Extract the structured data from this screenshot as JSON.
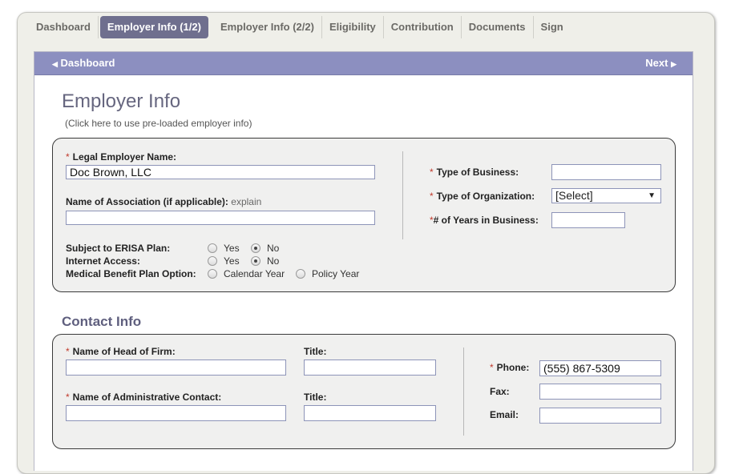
{
  "tabs": [
    "Dashboard",
    "Employer Info (1/2)",
    "Employer Info (2/2)",
    "Eligibility",
    "Contribution",
    "Documents",
    "Sign"
  ],
  "active_tab": "Employer Info (1/2)",
  "nav": {
    "back": "Dashboard",
    "next": "Next"
  },
  "page": {
    "title": "Employer Info",
    "preload_hint": "(Click here to use pre-loaded employer info)"
  },
  "employer": {
    "legal_name_label": "Legal Employer Name:",
    "legal_name_value": "Doc Brown, LLC",
    "association_label": "Name of Association (if applicable):",
    "association_explain": "explain",
    "association_value": "",
    "erisa_label": "Subject to ERISA Plan:",
    "internet_label": "Internet Access:",
    "medical_label": "Medical Benefit Plan Option:",
    "yes": "Yes",
    "no": "No",
    "calendar_year": "Calendar Year",
    "policy_year": "Policy Year",
    "erisa_selected": "No",
    "internet_selected": "No",
    "type_business_label": "Type of Business:",
    "type_business_value": "",
    "type_org_label": "Type of Organization:",
    "type_org_value": "[Select]",
    "years_label": "# of Years in Business:",
    "years_value": ""
  },
  "contact": {
    "section_title": "Contact Info",
    "head_label": "Name of Head of Firm:",
    "title_label": "Title:",
    "admin_label": "Name of Administrative Contact:",
    "phone_label": "Phone:",
    "phone_value": "(555) 867-5309",
    "fax_label": "Fax:",
    "email_label": "Email:"
  },
  "required_marker": "*",
  "colors": {
    "nav_bar": "#8c8fc0",
    "active_tab": "#6f6f8e",
    "required": "#c0392b",
    "heading": "#66667f"
  },
  "icons": {
    "back": "left-triangle-icon",
    "next": "right-triangle-icon",
    "dropdown": "down-triangle-icon"
  }
}
